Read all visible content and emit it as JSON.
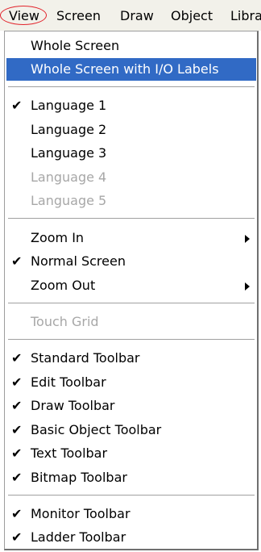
{
  "menubar": {
    "items": [
      "View",
      "Screen",
      "Draw",
      "Object",
      "Libra"
    ]
  },
  "menu": {
    "items": [
      {
        "label": "Whole Screen",
        "checked": false,
        "disabled": false
      },
      {
        "label": "Whole Screen with I/O Labels",
        "checked": false,
        "disabled": false,
        "selected": true
      },
      {
        "label": "Language 1",
        "checked": true,
        "disabled": false
      },
      {
        "label": "Language 2",
        "checked": false,
        "disabled": false
      },
      {
        "label": "Language 3",
        "checked": false,
        "disabled": false
      },
      {
        "label": "Language 4",
        "checked": false,
        "disabled": true
      },
      {
        "label": "Language 5",
        "checked": false,
        "disabled": true
      },
      {
        "label": "Zoom In",
        "checked": false,
        "disabled": false,
        "submenu": true
      },
      {
        "label": "Normal Screen",
        "checked": true,
        "disabled": false
      },
      {
        "label": "Zoom Out",
        "checked": false,
        "disabled": false,
        "submenu": true
      },
      {
        "label": "Touch Grid",
        "checked": false,
        "disabled": true
      },
      {
        "label": "Standard Toolbar",
        "checked": true,
        "disabled": false
      },
      {
        "label": "Edit Toolbar",
        "checked": true,
        "disabled": false
      },
      {
        "label": "Draw Toolbar",
        "checked": true,
        "disabled": false
      },
      {
        "label": "Basic Object Toolbar",
        "checked": true,
        "disabled": false
      },
      {
        "label": "Text Toolbar",
        "checked": true,
        "disabled": false
      },
      {
        "label": "Bitmap Toolbar",
        "checked": true,
        "disabled": false
      },
      {
        "label": "Monitor Toolbar",
        "checked": true,
        "disabled": false
      },
      {
        "label": "Ladder Toolbar",
        "checked": true,
        "disabled": false
      }
    ],
    "check_glyph": "✔"
  },
  "colors": {
    "selection": "#316ac5",
    "disabled_text": "#a7a7a7",
    "menubar_bg": "#f2f1ea",
    "view_circle": "#e2232b"
  }
}
